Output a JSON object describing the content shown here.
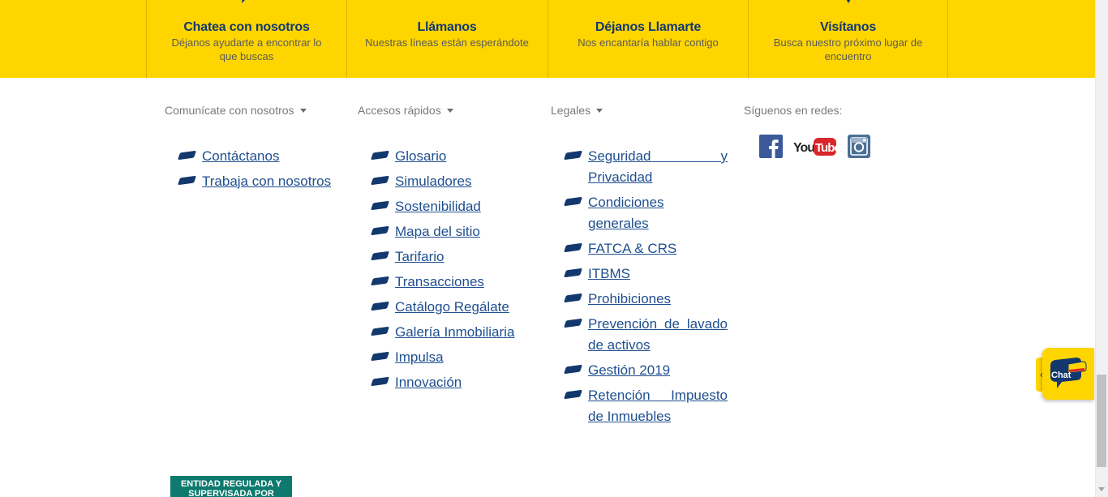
{
  "contact_band": [
    {
      "icon": "chat-bubble-icon",
      "title": "Chatea con nosotros",
      "subtitle": "Déjanos ayudarte a encontrar lo que buscas"
    },
    {
      "icon": "phone-icon",
      "title": "Llámanos",
      "subtitle": "Nuestras líneas están esperándote"
    },
    {
      "icon": "callback-phone-icon",
      "title": "Déjanos Llamarte",
      "subtitle": "Nos encantaría hablar contigo"
    },
    {
      "icon": "location-pin-icon",
      "title": "Visítanos",
      "subtitle": "Busca nuestro próximo lugar de encuentro"
    }
  ],
  "footer": {
    "comunicate": {
      "heading": "Comunícate con nosotros",
      "links": [
        "Contáctanos",
        "Trabaja con nosotros"
      ]
    },
    "accesos": {
      "heading": "Accesos rápidos",
      "links": [
        "Glosario",
        "Simuladores",
        "Sostenibilidad",
        "Mapa del sitio",
        "Tarifario",
        "Transacciones",
        "Catálogo Regálate",
        "Galería Inmobiliaria",
        "Impulsa",
        "Innovación"
      ]
    },
    "legales": {
      "heading": "Legales",
      "links": [
        "Seguridad y Privacidad",
        "Condiciones generales",
        "FATCA & CRS",
        "ITBMS",
        "Prohibiciones",
        "Prevención de lavado de activos",
        "Gestión 2019",
        "Retención Impuesto de Inmuebles"
      ]
    },
    "social": {
      "heading": "Síguenos en redes:",
      "networks": [
        "facebook-icon",
        "youtube-icon",
        "instagram-icon"
      ],
      "youtube_text": "You",
      "youtube_tube": "Tube"
    }
  },
  "chat_widget": {
    "label": "Chat",
    "toggle": "‹"
  },
  "badge": {
    "text": "ENTIDAD REGULADA Y SUPERVISADA POR"
  },
  "colors": {
    "band": "#FFD500",
    "brand_navy": "#12386d",
    "link": "#1f4f8f",
    "badge": "#0e7a6f"
  }
}
